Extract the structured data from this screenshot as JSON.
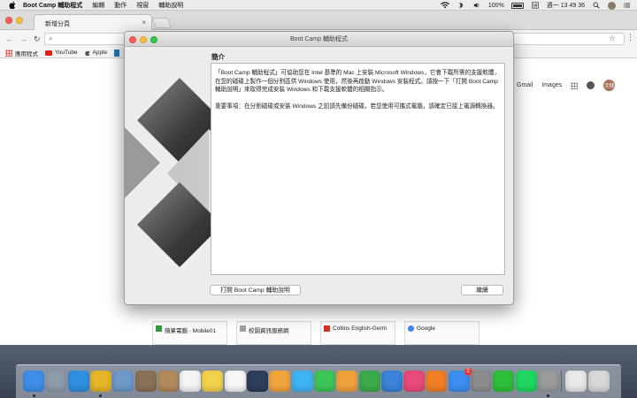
{
  "menubar": {
    "app_name": "Boot Camp 輔助程式",
    "items": [
      "編輯",
      "動作",
      "視窗",
      "輔助說明"
    ],
    "battery": "100%",
    "clock": "週一 13 49 36"
  },
  "browser": {
    "tab_title": "新增分頁",
    "bookmarks": [
      {
        "label": "應用程式",
        "icon": "apps-icon"
      },
      {
        "label": "YouTube",
        "icon": "youtube-icon"
      },
      {
        "label": "Apple",
        "icon": "apple-icon"
      },
      {
        "label": "",
        "icon": "bookmark-b-icon"
      }
    ],
    "google_links": {
      "gmail": "Gmail",
      "images": "Images",
      "user_initials": "宇翔"
    },
    "tiles": [
      {
        "label": "蘋果電腦 - Mobile01",
        "color": "#2e9a3e"
      },
      {
        "label": "校園資訊服務網",
        "color": "#9aa0a6"
      },
      {
        "label": "Collins English-Germ",
        "color": "#d93025"
      },
      {
        "label": "Google",
        "color": "#4285f4"
      }
    ]
  },
  "dialog": {
    "title": "Boot Camp 輔助程式",
    "section_title": "簡介",
    "paragraphs": [
      "「Boot Camp 輔助程式」可協助您在 Intel 基準的 Mac 上安裝 Microsoft Windows，它會下載所需的支援軟體，在您的磁碟上製作一個分割區供 Windows 使用，然後再啟動 Windows 安裝程式。請按一下「打開 Boot Camp 輔助說明」來取得完成安裝 Windows 和下載支援軟體的相關指示。",
      "重要事項：在分割磁碟或安裝 Windows 之前請先備份磁碟。若您使用可攜式電腦，請確定已接上電源轉換器。"
    ],
    "help_button": "打開 Boot Camp 輔助說明",
    "continue_button": "繼續"
  },
  "dock": {
    "apps": [
      {
        "name": "finder-icon",
        "color": "#3d8ee8",
        "running": true
      },
      {
        "name": "launchpad-icon",
        "color": "#8d9aaa",
        "running": false
      },
      {
        "name": "safari-icon",
        "color": "#2f8fe0",
        "running": false
      },
      {
        "name": "chrome-icon",
        "color": "#e6b628",
        "running": true
      },
      {
        "name": "preview-icon",
        "color": "#6d98c8",
        "running": false
      },
      {
        "name": "photo-slideshow-icon",
        "color": "#8a7056",
        "running": false
      },
      {
        "name": "contacts-icon",
        "color": "#b08a5c",
        "running": false
      },
      {
        "name": "calendar-icon",
        "color": "#f4f4f4",
        "running": false
      },
      {
        "name": "notes-icon",
        "color": "#f2d24a",
        "running": false
      },
      {
        "name": "reminders-icon",
        "color": "#f6f6f6",
        "running": false
      },
      {
        "name": "mission-control-icon",
        "color": "#2c3e5a",
        "running": false
      },
      {
        "name": "photos-icon",
        "color": "#f1a43c",
        "running": false
      },
      {
        "name": "messages-icon",
        "color": "#3fb4f5",
        "running": false
      },
      {
        "name": "facetime-icon",
        "color": "#3dc457",
        "running": false
      },
      {
        "name": "pages-icon",
        "color": "#f0a23a",
        "running": false
      },
      {
        "name": "numbers-icon",
        "color": "#3bab4a",
        "running": false
      },
      {
        "name": "keynote-icon",
        "color": "#3b82d8",
        "running": false
      },
      {
        "name": "itunes-icon",
        "color": "#e84a7a",
        "running": false
      },
      {
        "name": "ibooks-icon",
        "color": "#f07e26",
        "running": false
      },
      {
        "name": "app-store-icon",
        "color": "#3c8ef0",
        "running": false
      },
      {
        "name": "system-preferences-icon",
        "color": "#8c8c8c",
        "running": false
      },
      {
        "name": "line-icon",
        "color": "#2fbf3a",
        "running": false
      },
      {
        "name": "spotify-icon",
        "color": "#1ed760",
        "running": false
      },
      {
        "name": "bootcamp-icon",
        "color": "#9a9a9a",
        "running": true
      },
      {
        "name": "downloads-folder-icon",
        "color": "#e9e9e9",
        "running": false
      },
      {
        "name": "trash-icon",
        "color": "#d8d8d8",
        "running": false
      }
    ],
    "badge": "2"
  }
}
